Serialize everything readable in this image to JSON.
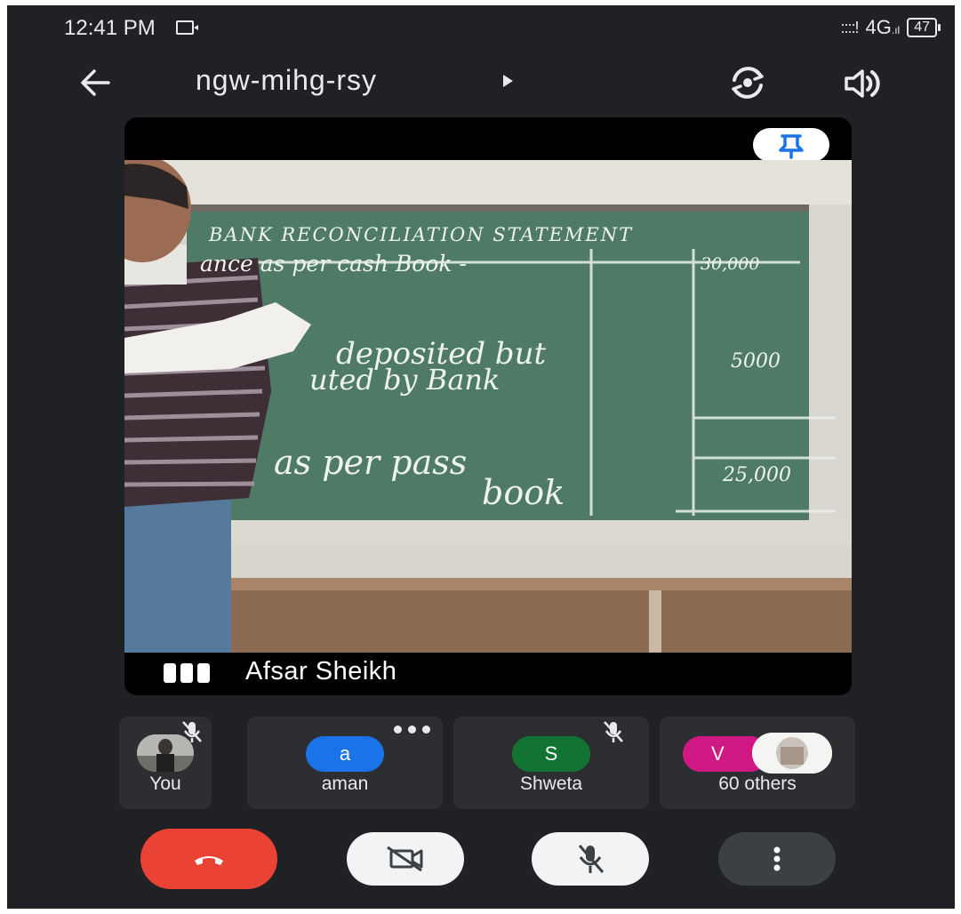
{
  "status_bar": {
    "time": "12:41 PM",
    "network": "4G",
    "battery": "47",
    "signal": "::::!"
  },
  "header": {
    "meeting_code": "ngw-mihg-rsy",
    "icons": [
      "back-arrow-icon",
      "play-arrow-icon",
      "switch-camera-icon",
      "speaker-icon"
    ]
  },
  "main_tile": {
    "speaker_name": "Afsar Sheikh",
    "pin_icon": "pin-icon",
    "board_text": {
      "heading": "BANK RECONCILIATION STATEMENT",
      "line1": "ance as per cash Book -",
      "amount1": "30,000",
      "line2a": "deposited but",
      "line2b": "uted by Bank",
      "amount2": "5000",
      "line3a": "as per pass",
      "line3b": "book",
      "amount3": "25,000"
    }
  },
  "participants": [
    {
      "name": "You",
      "avatar": "photo",
      "muted": true
    },
    {
      "name": "aman",
      "avatar_letter": "a",
      "avatar_color": "#1a73e8",
      "more_options": true
    },
    {
      "name": "Shweta",
      "avatar_letter": "S",
      "avatar_color": "#137333",
      "muted": true
    },
    {
      "name": "60 others",
      "avatar_letter": "V",
      "avatar_color": "#d01884"
    }
  ],
  "controls": {
    "end_call_color": "#ea4335",
    "icons": [
      "end-call-icon",
      "camera-off-icon",
      "mic-off-icon",
      "more-vert-icon"
    ]
  },
  "colors": {
    "background": "#202124",
    "card": "#2d2e31",
    "chalkboard": "#4f7a66",
    "pin": "#1a73e8"
  }
}
